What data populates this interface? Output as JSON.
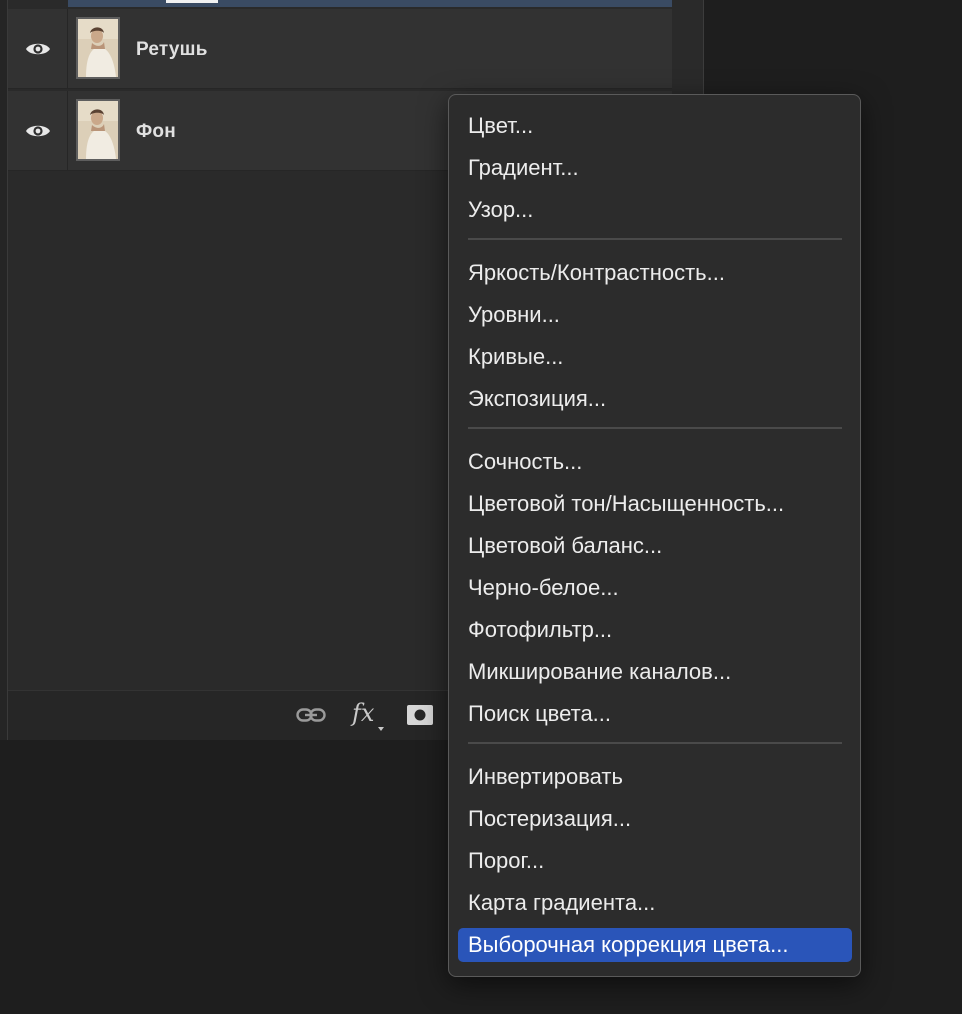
{
  "layers": {
    "items": [
      {
        "name": "Ретушь",
        "visible": true
      },
      {
        "name": "Фон",
        "visible": true
      }
    ]
  },
  "footer_icons": [
    "link-icon",
    "fx-icon",
    "mask-icon"
  ],
  "footer": {
    "fx_label": "fx"
  },
  "menu": {
    "groups": [
      [
        "Цвет...",
        "Градиент...",
        "Узор..."
      ],
      [
        "Яркость/Контрастность...",
        "Уровни...",
        "Кривые...",
        "Экспозиция..."
      ],
      [
        "Сочность...",
        "Цветовой тон/Насыщенность...",
        "Цветовой баланс...",
        "Черно-белое...",
        "Фотофильтр...",
        "Микширование каналов...",
        "Поиск цвета..."
      ],
      [
        "Инвертировать",
        "Постеризация...",
        "Порог...",
        "Карта градиента...",
        "Выборочная коррекция цвета..."
      ]
    ],
    "highlighted": "Выборочная коррекция цвета..."
  },
  "colors": {
    "highlight": "#2a55b9",
    "panel": "#2a2a2a",
    "menu_bg": "#2c2c2c",
    "selected_layer": "#3a4b63"
  }
}
